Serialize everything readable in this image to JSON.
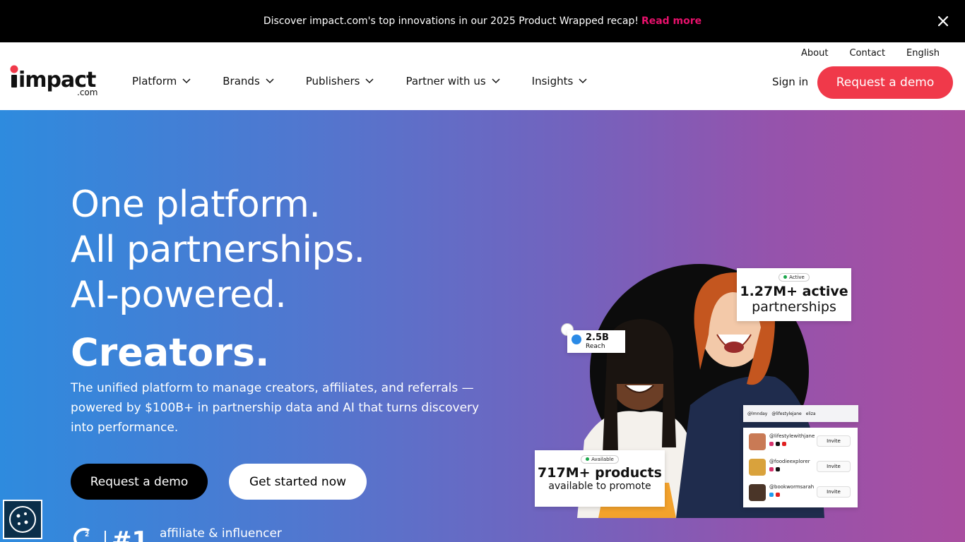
{
  "announcement": {
    "text": "Discover impact.com's top innovations in our 2025 Product Wrapped recap!",
    "link": "Read more"
  },
  "logo": {
    "word": "impact",
    "suffix": ".com"
  },
  "utility_nav": {
    "about": "About",
    "contact": "Contact",
    "language": "English"
  },
  "main_nav": {
    "items": [
      {
        "label": "Platform"
      },
      {
        "label": "Brands"
      },
      {
        "label": "Publishers"
      },
      {
        "label": "Partner with us"
      },
      {
        "label": "Insights"
      }
    ],
    "sign_in": "Sign in",
    "cta": "Request a demo"
  },
  "hero": {
    "line1": "One platform.",
    "line2": "All partnerships.",
    "line3": "AI-powered.",
    "rotating_word": "Creators.",
    "subtitle": "The unified platform to manage creators, affiliates, and referrals — powered by $100B+ in partnership data and AI that turns discovery into performance.",
    "primary_cta": "Request a demo",
    "secondary_cta": "Get started now",
    "badge_rank": "#1",
    "badge_text": "affiliate & influencer"
  },
  "illustration": {
    "active_pill": "Active",
    "active_line1": "1.27M+ active",
    "active_line2": "partnerships",
    "reach_value": "2.5B",
    "reach_label": "Reach",
    "products_pill": "Available",
    "products_line1": "717M+ products",
    "products_line2": "available to promote",
    "tabs": [
      "@lmnday",
      "@lifestylejane",
      "eliza"
    ],
    "creators": [
      {
        "handle": "@lifestylewithjane",
        "action": "Invite"
      },
      {
        "handle": "@foodieexplorer",
        "action": "Invite"
      },
      {
        "handle": "@bookwormsarah",
        "action": "Invite"
      }
    ]
  },
  "colors": {
    "accent": "#f0394a",
    "link": "#e8116c",
    "gradient_start": "#2e8bde",
    "gradient_end": "#a94ea0"
  }
}
